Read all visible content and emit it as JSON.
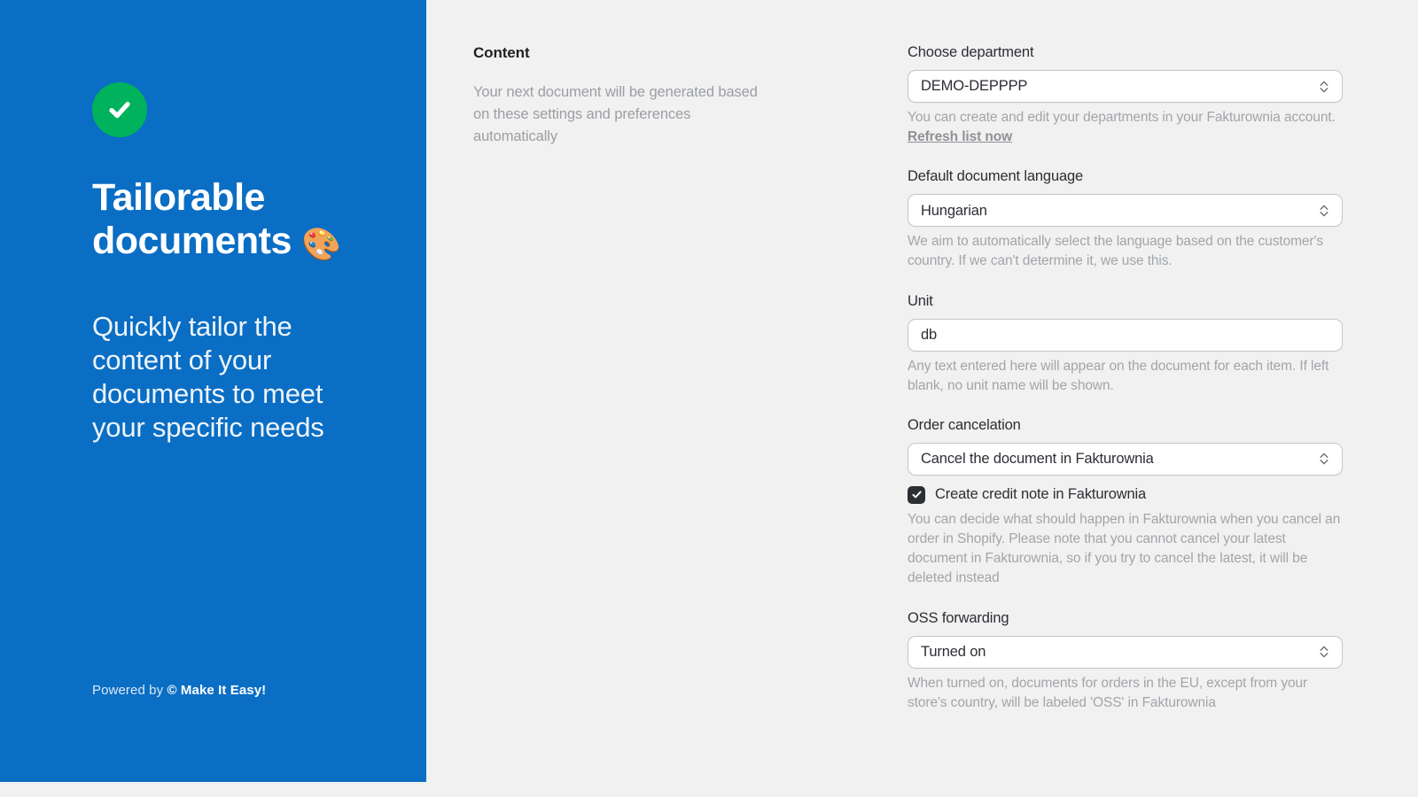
{
  "promo": {
    "icon": "check-circle-icon",
    "title_line1": "Tailorable",
    "title_line2": "documents",
    "title_emoji": "🎨",
    "subtitle": "Quickly tailor the content of your documents to meet your specific needs",
    "footer_prefix": "Powered by ",
    "footer_brand": "© Make It Easy!",
    "background_color": "#0a6ec4",
    "badge_color": "#00b25c"
  },
  "content_section": {
    "heading": "Content",
    "description": "Your next document will be generated based on these settings and preferences automatically"
  },
  "form": {
    "fields": [
      {
        "label": "Choose department",
        "type": "select",
        "value": "DEMO-DEPPPP",
        "help_before": "You can create and edit your departments in your Fakturownia account.",
        "help_link": " Refresh list now"
      },
      {
        "label": "Default document language",
        "type": "select",
        "value": "Hungarian",
        "help": "We aim to automatically select the language based on the customer's country. If we can't determine it, we use this."
      },
      {
        "label": "Unit",
        "type": "text",
        "value": "db",
        "placeholder": "db",
        "help": "Any text entered here will appear on the document for each item. If left blank, no unit name will be shown."
      },
      {
        "label": "Order cancelation",
        "type": "select",
        "value": "Cancel the document in Fakturownia",
        "checkbox_label": "Create credit note in Fakturownia",
        "checkbox_checked": true,
        "help": "You can decide what should happen in Fakturownia when you cancel an order in Shopify. Please note that you cannot cancel your latest document in Fakturownia, so if you try to cancel the latest, it will be deleted instead"
      },
      {
        "label": "OSS forwarding",
        "type": "select",
        "value": "Turned on",
        "help": "When turned on, documents for orders in the EU, except from your store's country, will be labeled 'OSS' in Fakturownia"
      }
    ]
  }
}
